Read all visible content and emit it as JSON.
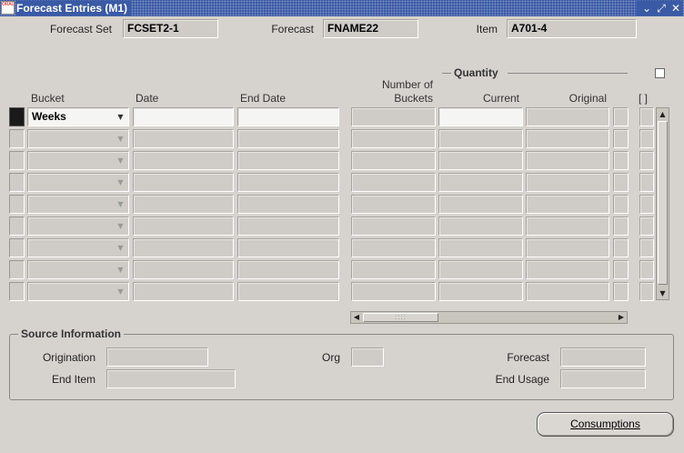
{
  "window": {
    "title": "Forecast Entries (M1)",
    "app_icon_label": "ORACLE",
    "controls": {
      "minimize": "⌄",
      "restore": "⤢",
      "close": "✕"
    }
  },
  "header": {
    "forecast_set_label": "Forecast Set",
    "forecast_set_value": "FCSET2-1",
    "forecast_label": "Forecast",
    "forecast_value": "FNAME22",
    "item_label": "Item",
    "item_value": "A701-4"
  },
  "grid": {
    "quantity_group_label": "Quantity",
    "columns": {
      "bucket": "Bucket",
      "date": "Date",
      "end_date": "End Date",
      "number_of_buckets_line1": "Number of",
      "number_of_buckets_line2": "Buckets",
      "current": "Current",
      "original": "Original",
      "flex": "[ ]"
    },
    "rows": [
      {
        "bucket": "Weeks"
      },
      {
        "bucket": ""
      },
      {
        "bucket": ""
      },
      {
        "bucket": ""
      },
      {
        "bucket": ""
      },
      {
        "bucket": ""
      },
      {
        "bucket": ""
      },
      {
        "bucket": ""
      },
      {
        "bucket": ""
      }
    ]
  },
  "source_information": {
    "title": "Source Information",
    "origination_label": "Origination",
    "origination_value": "",
    "org_label": "Org",
    "org_value": "",
    "forecast_label": "Forecast",
    "forecast_value": "",
    "end_item_label": "End Item",
    "end_item_value": "",
    "end_usage_label": "End Usage",
    "end_usage_value": ""
  },
  "actions": {
    "consumptions_label": "Consumptions"
  }
}
